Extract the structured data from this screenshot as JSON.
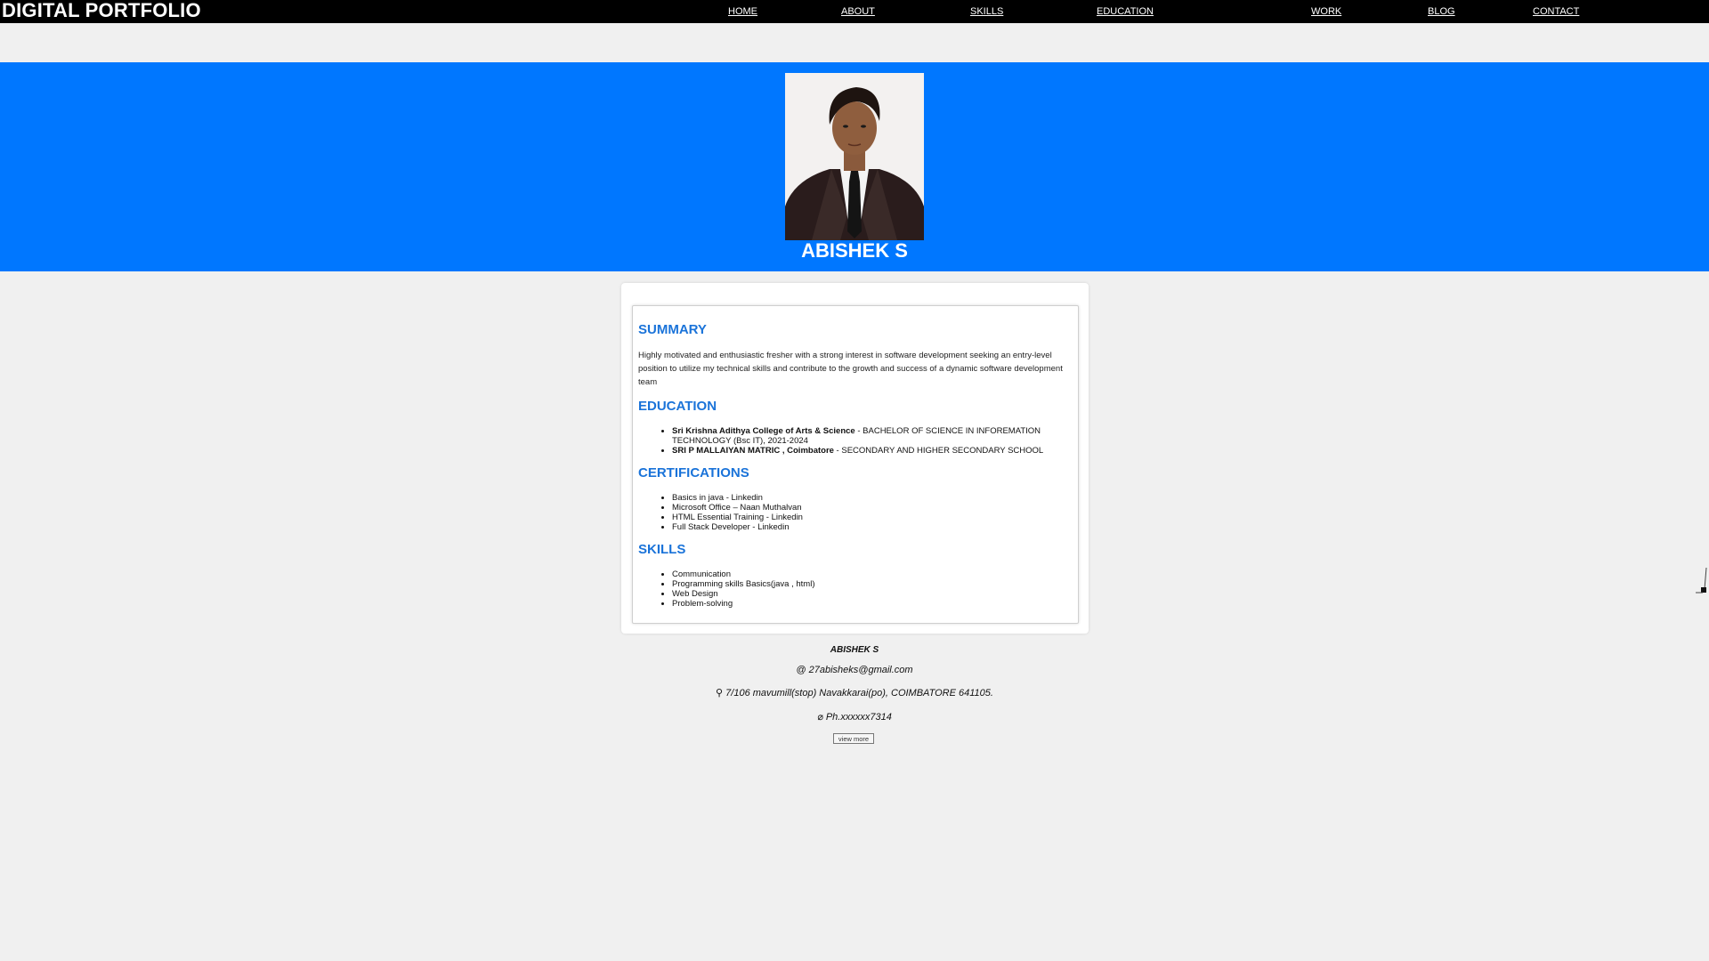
{
  "nav": {
    "brand": "DIGITAL PORTFOLIO",
    "links": [
      "HOME",
      "ABOUT",
      "SKILLS",
      "EDUCATION",
      "WORK",
      "BLOG",
      "CONTACT"
    ]
  },
  "hero": {
    "name": "ABISHEK S",
    "background": "#0077ff"
  },
  "resume": {
    "summary": {
      "title": "SUMMARY",
      "text": "Highly motivated and enthusiastic fresher with a strong interest in software development seeking an entry-level position to utilize my technical skills and contribute to the growth and success of a dynamic software development team"
    },
    "education": {
      "title": "EDUCATION",
      "items": [
        {
          "school": "Sri Krishna Adithya College of Arts & Science",
          "detail": " - BACHELOR OF SCIENCE IN INFOREMATION TECHNOLOGY (Bsc IT), 2021-2024"
        },
        {
          "school": "SRI P MALLAIYAN MATRIC , Coimbatore",
          "detail": " - SECONDARY AND HIGHER SECONDARY SCHOOL"
        }
      ]
    },
    "certifications": {
      "title": "CERTIFICATIONS",
      "items": [
        "Basics in java - Linkedin",
        "Microsoft Office – Naan Muthalvan",
        "HTML Essential Training - Linkedin",
        "Full Stack Developer - Linkedin"
      ]
    },
    "skills": {
      "title": "SKILLS",
      "items": [
        "Communication",
        "Programming skills Basics(java , html)",
        "Web Design",
        "Problem-solving"
      ]
    },
    "accent_color": "#1a73d9"
  },
  "footer": {
    "name": "ABISHEK S",
    "email": "@ 27abisheks@gmail.com",
    "address": "⚲ 7/106 mavumill(stop) Navakkarai(po), COIMBATORE 641105.",
    "phone": "⌀ Ph.xxxxxx7314",
    "view_more": "view more"
  }
}
